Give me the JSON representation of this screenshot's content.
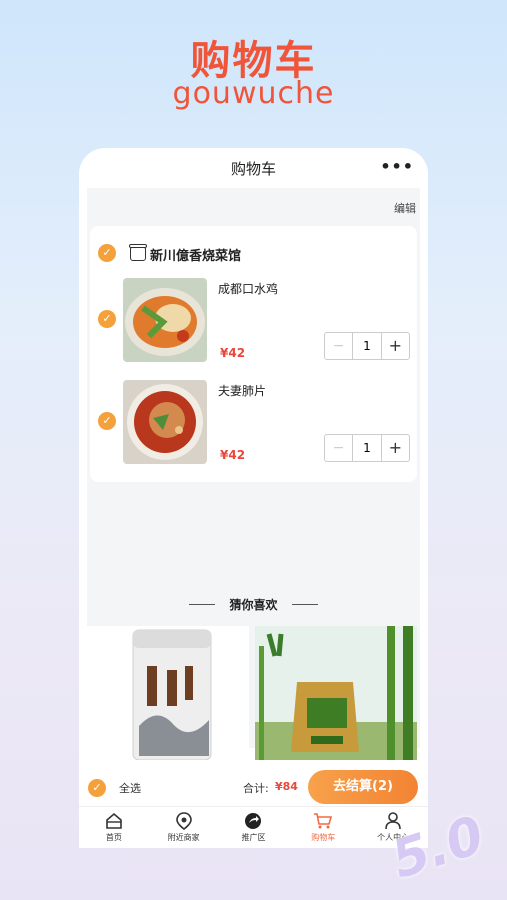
{
  "hero": {
    "title": "购物车",
    "subtitle": "gouwuche",
    "badge": "5.0"
  },
  "navbar": {
    "title": "购物车",
    "more_icon": "more-dots-icon"
  },
  "cart": {
    "edit_label": "编辑",
    "shop": {
      "name": "新川億香烧菜馆",
      "icon": "shop-icon"
    },
    "items": [
      {
        "name": "成都口水鸡",
        "price": "¥42",
        "quantity": "1"
      },
      {
        "name": "夫妻肺片",
        "price": "¥42",
        "quantity": "1"
      }
    ],
    "stepper": {
      "minus": "−",
      "plus": "+"
    }
  },
  "recommend": {
    "title": "猜你喜欢"
  },
  "checkout": {
    "select_all_label": "全选",
    "total_label": "合计:",
    "total_value": "¥84",
    "button_label": "去结算(2)"
  },
  "tabbar": {
    "items": [
      {
        "label": "首页",
        "icon": "home-icon"
      },
      {
        "label": "附近商家",
        "icon": "location-icon"
      },
      {
        "label": "推广区",
        "icon": "share-icon"
      },
      {
        "label": "购物车",
        "icon": "cart-icon",
        "active": true
      },
      {
        "label": "个人中心",
        "icon": "user-icon"
      }
    ]
  },
  "colors": {
    "accent": "#f5a13b",
    "price": "#e8473b",
    "title": "#f0553a"
  }
}
